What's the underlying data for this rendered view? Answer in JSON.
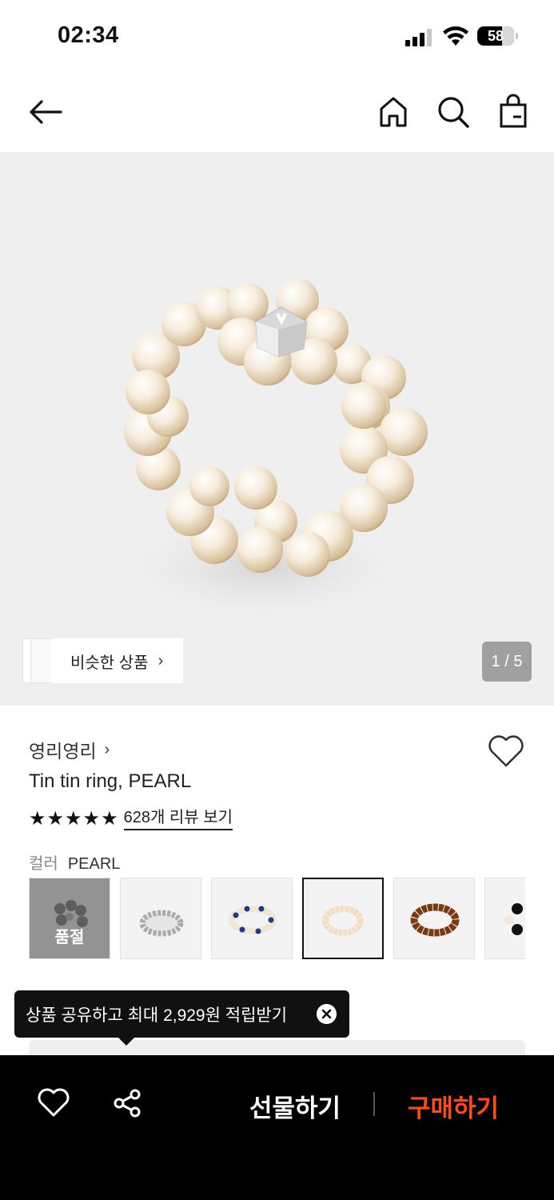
{
  "status_bar": {
    "time": "02:34",
    "battery": "58"
  },
  "nav": {
    "back_icon": "arrow-left-icon",
    "home_icon": "home-icon",
    "search_icon": "search-icon",
    "bag_icon": "shopping-bag-icon"
  },
  "hero": {
    "similar_label": "비슷한 상품",
    "page_counter": "1 / 5"
  },
  "product": {
    "brand": "영리영리",
    "name": "Tin tin ring, PEARL",
    "rating_stars": 5,
    "review_link": "628개 리뷰 보기",
    "color_label": "컬러",
    "color_value": "PEARL",
    "swatches": [
      {
        "name": "olive",
        "sold_out": true,
        "sold_out_label": "품절"
      },
      {
        "name": "silver",
        "sold_out": false
      },
      {
        "name": "blue-white",
        "sold_out": false
      },
      {
        "name": "pearl",
        "sold_out": false,
        "selected": true
      },
      {
        "name": "amber",
        "sold_out": false
      },
      {
        "name": "black-white",
        "sold_out": false
      }
    ]
  },
  "tooltip": {
    "text": "상품 공유하고 최대 2,929원 적립받기"
  },
  "bottom_bar": {
    "gift_label": "선물하기",
    "buy_label": "구매하기",
    "buy_color": "#ff4b12"
  }
}
